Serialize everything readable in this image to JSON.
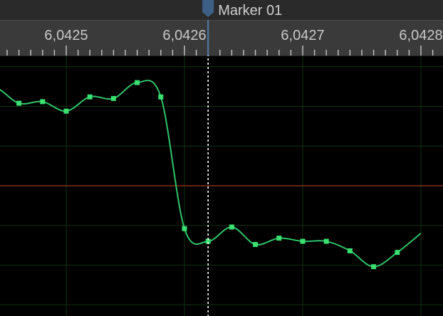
{
  "marker": {
    "label": "Marker 01",
    "time": 6.04262,
    "color": "#3d5f86",
    "line_color": "#ffffff",
    "icon": "marker-flag-icon"
  },
  "ruler": {
    "tick_labels": [
      "6,0425",
      "6,0426",
      "6,0427",
      "6,0428"
    ],
    "tick_values": [
      6.0425,
      6.0426,
      6.0427,
      6.0428
    ]
  },
  "waveform": {
    "color": "#2fc46a",
    "sample_color": "#39e070",
    "grid_color": "#0f3312",
    "zero_line_color": "#8a2a1f",
    "sample_times": [
      6.04244,
      6.04246,
      6.04248,
      6.0425,
      6.04252,
      6.04254,
      6.04256,
      6.04258,
      6.0426,
      6.04262,
      6.04264,
      6.04266,
      6.04268,
      6.0427,
      6.04272,
      6.04274,
      6.04276,
      6.04278
    ],
    "sample_values": [
      0.62,
      0.52,
      0.53,
      0.47,
      0.56,
      0.55,
      0.65,
      0.56,
      -0.27,
      -0.35,
      -0.26,
      -0.37,
      -0.33,
      -0.35,
      -0.35,
      -0.41,
      -0.51,
      -0.42
    ]
  }
}
